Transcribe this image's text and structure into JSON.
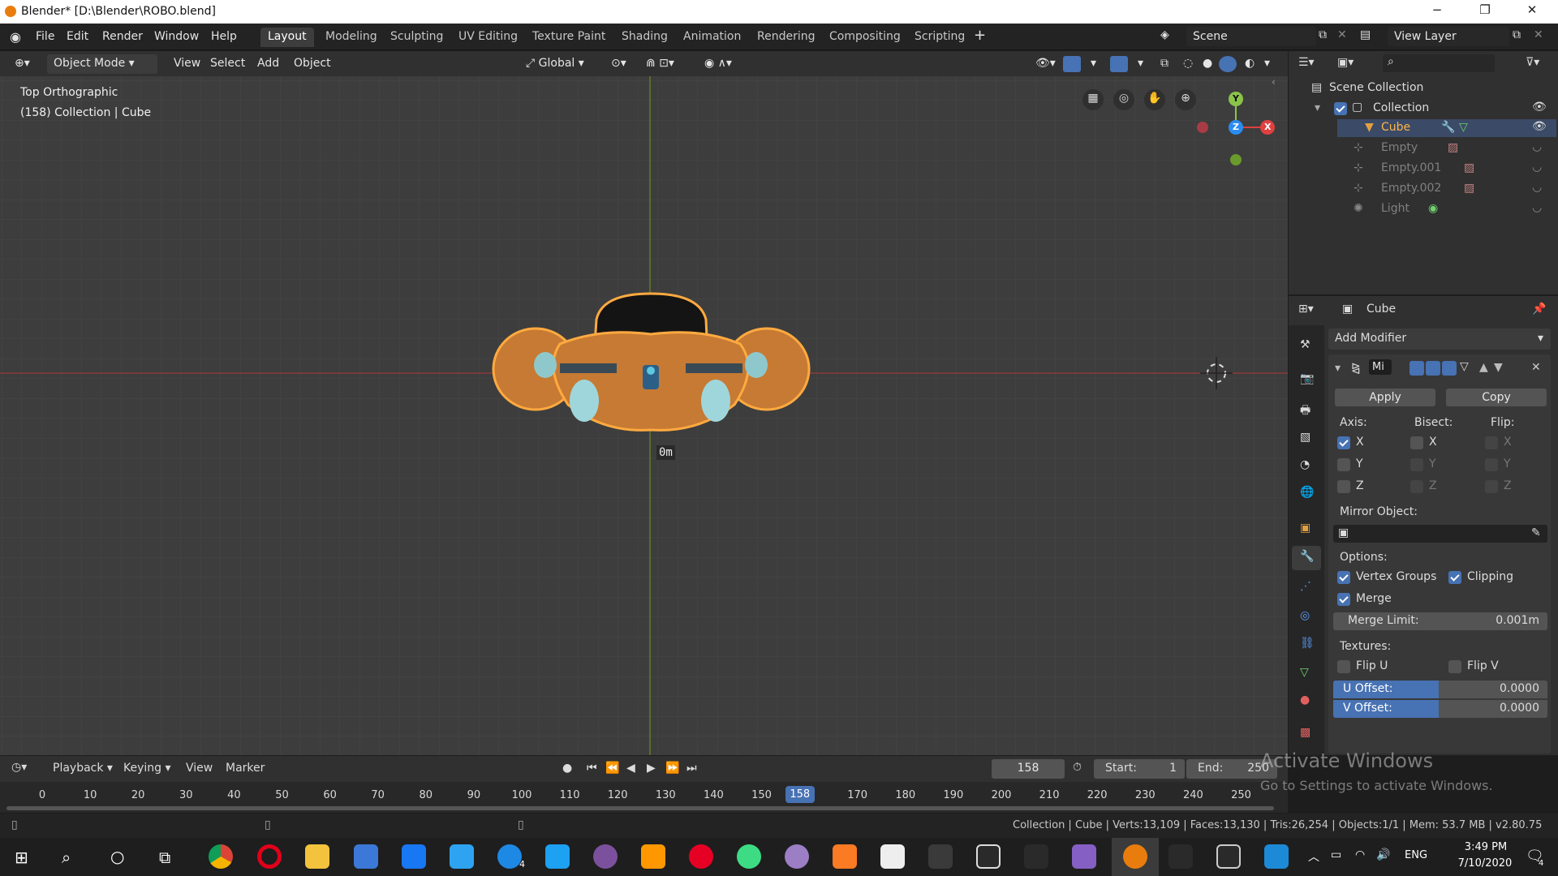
{
  "window": {
    "title": "Blender* [D:\\Blender\\ROBO.blend]",
    "minimize": "−",
    "maximize": "❐",
    "close": "✕"
  },
  "menu": {
    "file": "File",
    "edit": "Edit",
    "render": "Render",
    "window": "Window",
    "help": "Help"
  },
  "workspaces": [
    "Layout",
    "Modeling",
    "Sculpting",
    "UV Editing",
    "Texture Paint",
    "Shading",
    "Animation",
    "Rendering",
    "Compositing",
    "Scripting"
  ],
  "active_workspace": "Layout",
  "scene": {
    "name": "Scene",
    "view_layer": "View Layer"
  },
  "viewport_header": {
    "mode": "Object Mode",
    "view": "View",
    "select": "Select",
    "add": "Add",
    "object": "Object",
    "orientation": "Global"
  },
  "viewport": {
    "view_name": "Top Orthographic",
    "context": "(158) Collection | Cube",
    "scale_label": "0m",
    "gizmo": {
      "y": "Y",
      "z": "Z",
      "x": "X"
    }
  },
  "outliner": {
    "root": "Scene Collection",
    "collection": "Collection",
    "items": [
      {
        "name": "Cube",
        "selected": true
      },
      {
        "name": "Empty",
        "selected": false
      },
      {
        "name": "Empty.001",
        "selected": false
      },
      {
        "name": "Empty.002",
        "selected": false
      },
      {
        "name": "Light",
        "selected": false
      }
    ]
  },
  "properties": {
    "object_name": "Cube",
    "add_modifier": "Add Modifier",
    "modifier_short": "Mi",
    "apply": "Apply",
    "copy": "Copy",
    "axis_label": "Axis:",
    "bisect_label": "Bisect:",
    "flip_label": "Flip:",
    "axes": [
      "X",
      "Y",
      "Z"
    ],
    "axis_checked": [
      true,
      false,
      false
    ],
    "mirror_object_label": "Mirror Object:",
    "options_label": "Options:",
    "vertex_groups": "Vertex Groups",
    "clipping": "Clipping",
    "merge": "Merge",
    "merge_limit_label": "Merge Limit:",
    "merge_limit_value": "0.001m",
    "textures_label": "Textures:",
    "flip_u": "Flip U",
    "flip_v": "Flip V",
    "u_offset_label": "U Offset:",
    "u_offset_value": "0.0000",
    "v_offset_label": "V Offset:",
    "v_offset_value": "0.0000"
  },
  "timeline": {
    "playback": "Playback",
    "keying": "Keying",
    "view": "View",
    "marker": "Marker",
    "current_frame": "158",
    "start_label": "Start:",
    "start": "1",
    "end_label": "End:",
    "end": "250",
    "ticks": [
      "0",
      "10",
      "20",
      "30",
      "40",
      "50",
      "60",
      "70",
      "80",
      "90",
      "100",
      "110",
      "120",
      "130",
      "140",
      "150",
      "158",
      "170",
      "180",
      "190",
      "200",
      "210",
      "220",
      "230",
      "240",
      "250"
    ]
  },
  "status": {
    "text": "Collection | Cube | Verts:13,109 | Faces:13,130 | Tris:26,254 | Objects:1/1 | Mem: 53.7 MB | v2.80.75"
  },
  "watermark": {
    "line1": "Activate Windows",
    "line2": "Go to Settings to activate Windows."
  },
  "taskbar": {
    "time": "3:49 PM",
    "date": "7/10/2020",
    "lang": "ENG",
    "messenger_badge": "4",
    "notif_badge": "4"
  },
  "colors": {
    "accent": "#4772b3",
    "selection": "#ffaa40",
    "x_axis": "#e04040",
    "y_axis": "#8bc34a",
    "z_axis": "#2b8cf0"
  }
}
